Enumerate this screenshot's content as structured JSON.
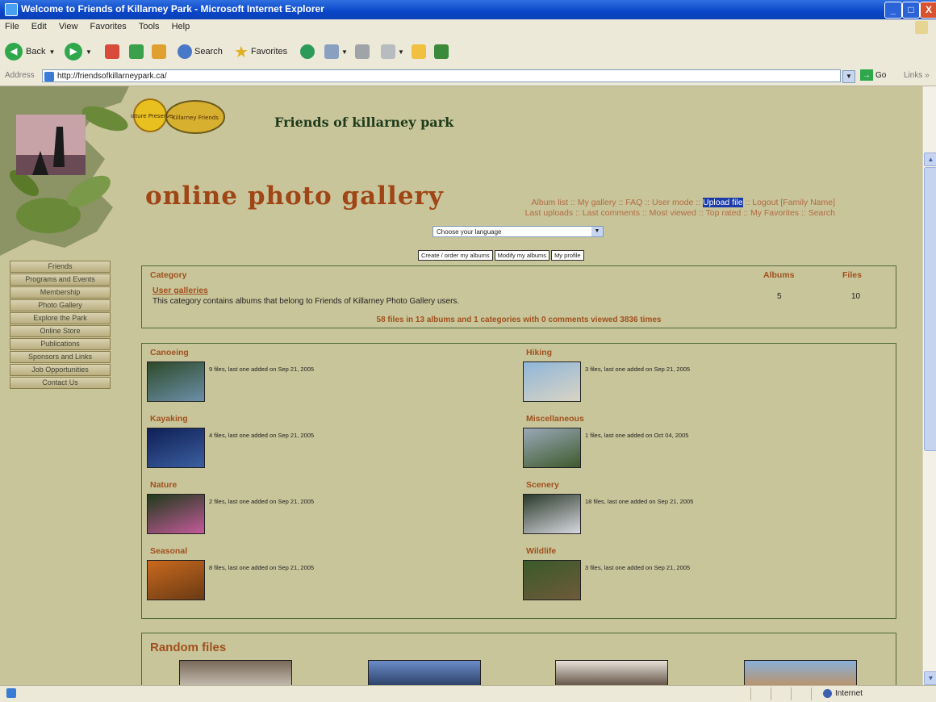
{
  "window": {
    "title": "Welcome to Friends of Killarney Park - Microsoft Internet Explorer",
    "min": "_",
    "max": "□",
    "close": "X"
  },
  "menu": [
    "File",
    "Edit",
    "View",
    "Favorites",
    "Tools",
    "Help"
  ],
  "toolbar": {
    "back": "Back",
    "search": "Search",
    "favorites": "Favorites"
  },
  "addressbar": {
    "label": "Address",
    "url": "http://friendsofkillarneypark.ca/",
    "go": "Go",
    "links": "Links »"
  },
  "statusbar": {
    "zone": "Internet"
  },
  "header": {
    "site_title": "Friends of killarney park",
    "gallery_title": "online photo gallery",
    "logos": [
      "Nature Preserve",
      "Killarney Friends"
    ]
  },
  "topnav": {
    "line1": [
      "Album list",
      "My gallery",
      "FAQ",
      "User mode",
      "Upload file",
      "Logout [Family Name]"
    ],
    "line2": [
      "Last uploads",
      "Last comments",
      "Most viewed",
      "Top rated",
      "My Favorites",
      "Search"
    ]
  },
  "language_select": {
    "value": "Choose your language"
  },
  "profile_buttons": [
    "Create / order my albums",
    "Modify my albums",
    "My profile"
  ],
  "leftnav": [
    "Friends",
    "Programs and Events",
    "Membership",
    "Photo Gallery",
    "Explore the Park",
    "Online Store",
    "Publications",
    "Sponsors and Links",
    "Job Opportunities",
    "Contact Us"
  ],
  "category_table": {
    "headers": {
      "category": "Category",
      "albums": "Albums",
      "files": "Files"
    },
    "row": {
      "name": "User galleries",
      "description": "This category contains albums that belong to Friends of Killarney Photo Gallery users.",
      "albums": "5",
      "files": "10"
    },
    "stats": "58 files in 13 albums and 1 categories with 0 comments viewed 3836 times"
  },
  "albums": [
    {
      "name": "Canoeing",
      "info": "9 files, last one added on Sep 21, 2005",
      "color_a": "#2e4a2a",
      "color_b": "#6b8fa8"
    },
    {
      "name": "Hiking",
      "info": "3 files, last one added on Sep 21, 2005",
      "color_a": "#8fb6d9",
      "color_b": "#d9d4c4"
    },
    {
      "name": "Kayaking",
      "info": "4 files, last one added on Sep 21, 2005",
      "color_a": "#0f1f55",
      "color_b": "#3b5fa0"
    },
    {
      "name": "Miscellaneous",
      "info": "1 files, last one added on Oct 04, 2005",
      "color_a": "#9aa8b8",
      "color_b": "#3e5a2c"
    },
    {
      "name": "Nature",
      "info": "2 files, last one added on Sep 21, 2005",
      "color_a": "#1f3a1a",
      "color_b": "#c45a9a"
    },
    {
      "name": "Scenery",
      "info": "18 files, last one added on Sep 21, 2005",
      "color_a": "#2a3a2a",
      "color_b": "#d8d8e0"
    },
    {
      "name": "Seasonal",
      "info": "8 files, last one added on Sep 21, 2005",
      "color_a": "#c9691e",
      "color_b": "#6a3a14"
    },
    {
      "name": "Wildlife",
      "info": "3 files, last one added on Sep 21, 2005",
      "color_a": "#3a5a2a",
      "color_b": "#6e5a3a"
    }
  ],
  "random_files": {
    "title": "Random files",
    "thumbs": [
      {
        "color_a": "#7a6a5a",
        "color_b": "#d8d2c8"
      },
      {
        "color_a": "#6a8cc8",
        "color_b": "#1a2a4a"
      },
      {
        "color_a": "#e8e0d8",
        "color_b": "#3a2a1a"
      },
      {
        "color_a": "#8ab0d8",
        "color_b": "#c88a4a"
      }
    ]
  }
}
